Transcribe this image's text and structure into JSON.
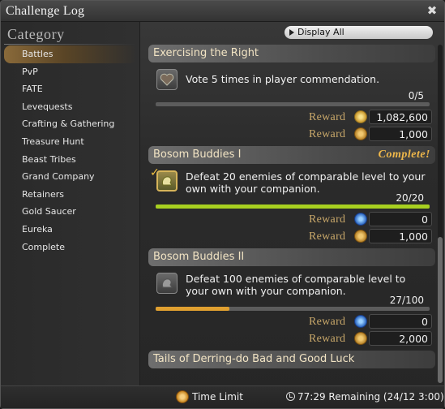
{
  "window": {
    "title": "Challenge Log",
    "close_glyph": "✖"
  },
  "sidebar": {
    "heading": "Category",
    "items": [
      {
        "label": "Battles",
        "selected": true
      },
      {
        "label": "PvP"
      },
      {
        "label": "FATE"
      },
      {
        "label": "Levequests"
      },
      {
        "label": "Crafting & Gathering"
      },
      {
        "label": "Treasure Hunt"
      },
      {
        "label": "Beast Tribes"
      },
      {
        "label": "Grand Company"
      },
      {
        "label": "Retainers"
      },
      {
        "label": "Gold Saucer"
      },
      {
        "label": "Eureka"
      },
      {
        "label": "Complete"
      }
    ]
  },
  "main": {
    "display_all_label": "Display All",
    "entries": [
      {
        "title": "Exercising the Right",
        "description": "Vote 5 times in player commendation.",
        "progress": "0/5",
        "progress_fraction": 0.0,
        "rewards": [
          {
            "label": "Reward",
            "icon": "seal-icon",
            "value": "1,082,600"
          },
          {
            "label": "Reward",
            "icon": "gil-icon",
            "value": "1,000"
          }
        ]
      },
      {
        "title": "Bosom Buddies I",
        "status": "Complete!",
        "description": "Defeat 20 enemies of comparable level to your own with your companion.",
        "progress": "20/20",
        "progress_fraction": 1.0,
        "bar_color": "#a8d020",
        "rewards": [
          {
            "label": "Reward",
            "icon": "mgp-icon",
            "value": "0"
          },
          {
            "label": "Reward",
            "icon": "gil-icon",
            "value": "1,000"
          }
        ]
      },
      {
        "title": "Bosom Buddies II",
        "description": "Defeat 100 enemies of comparable level to your own with your companion.",
        "progress": "27/100",
        "progress_fraction": 0.27,
        "bar_color": "#e0a030",
        "rewards": [
          {
            "label": "Reward",
            "icon": "mgp-icon",
            "value": "0"
          },
          {
            "label": "Reward",
            "icon": "gil-icon",
            "value": "2,000"
          }
        ]
      },
      {
        "title": "Tails of Derring-do Bad and Good Luck"
      }
    ]
  },
  "footer": {
    "time_limit_label": "Time Limit",
    "remaining_text": "77:29 Remaining  (24/12 3:00)"
  }
}
